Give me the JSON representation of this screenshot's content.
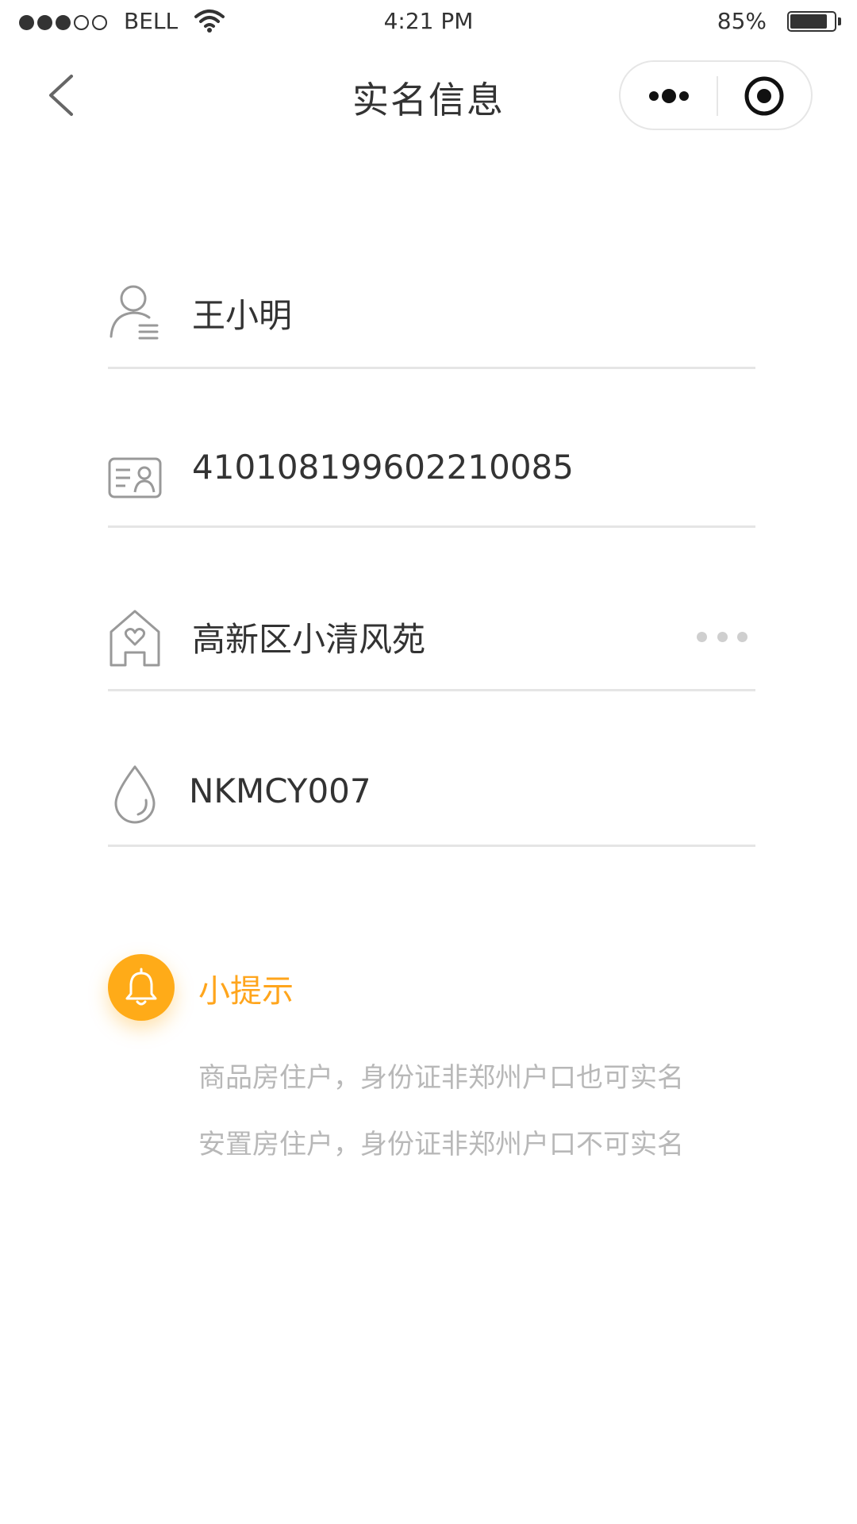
{
  "status_bar": {
    "carrier": "BELL",
    "time": "4:21 PM",
    "battery_percent": "85%",
    "battery_level": 0.85,
    "signal_bars_filled": 3,
    "signal_bars_total": 5
  },
  "nav": {
    "title": "实名信息",
    "back_icon": "chevron-left-icon",
    "more_icon": "more-dots-icon",
    "close_icon": "target-icon"
  },
  "form": {
    "name": {
      "icon": "user-icon",
      "value": "王小明"
    },
    "id_number": {
      "icon": "id-card-icon",
      "value": "410108199602210085"
    },
    "community": {
      "icon": "house-heart-icon",
      "value": "高新区小清风苑",
      "more_icon": "ellipsis-icon"
    },
    "code": {
      "icon": "water-drop-icon",
      "value": "NKMCY007"
    }
  },
  "tips": {
    "icon": "bell-icon",
    "title": "小提示",
    "lines": [
      "商品房住户，身份证非郑州户口也可实名",
      "安置房住户，身份证非郑州户口不可实名"
    ]
  },
  "colors": {
    "accent": "#ffab18",
    "text": "#333333",
    "hint_text": "#b8b8b8",
    "divider": "#e5e5e5",
    "icon_gray": "#999999"
  }
}
